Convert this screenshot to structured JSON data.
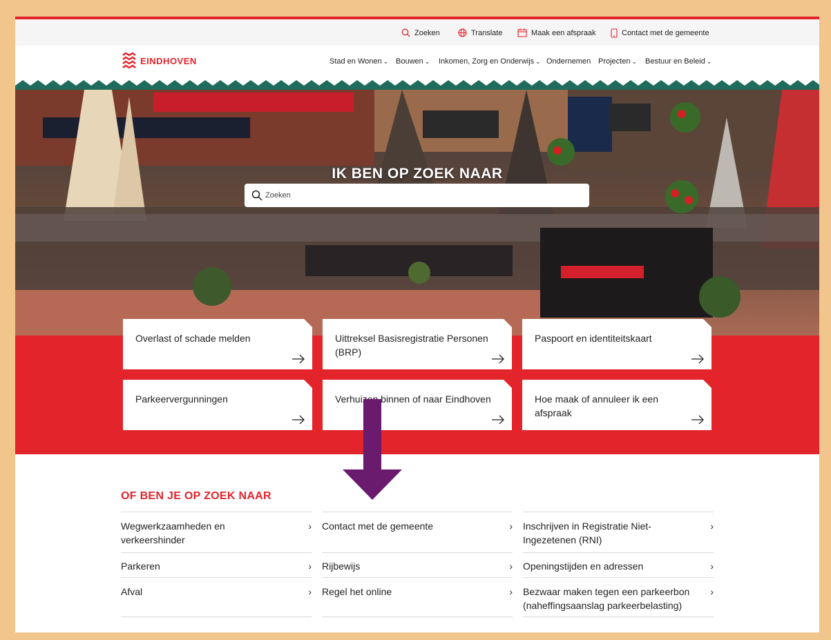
{
  "utility_bar": {
    "search": "Zoeken",
    "translate": "Translate",
    "appointment": "Maak een afspraak",
    "contact": "Contact met de gemeente"
  },
  "logo": {
    "text": "EINDHOVEN"
  },
  "nav": [
    {
      "label": "Stad en Wonen",
      "dropdown": true
    },
    {
      "label": "Bouwen",
      "dropdown": true
    },
    {
      "label": "Inkomen, Zorg en Onderwijs",
      "dropdown": true
    },
    {
      "label": "Ondernemen",
      "dropdown": false
    },
    {
      "label": "Projecten",
      "dropdown": true
    },
    {
      "label": "Bestuur en Beleid",
      "dropdown": true
    }
  ],
  "hero": {
    "title": "IK BEN OP ZOEK NAAR",
    "search_placeholder": "Zoeken"
  },
  "tiles": [
    {
      "label": "Overlast of schade melden"
    },
    {
      "label": "Uittreksel Basisregistratie Personen (BRP)"
    },
    {
      "label": "Paspoort en identiteitskaart"
    },
    {
      "label": "Parkeervergunningen"
    },
    {
      "label": "Verhuizen binnen of naar Eindhoven"
    },
    {
      "label": "Hoe maak of annuleer ik een afspraak"
    }
  ],
  "more": {
    "title": "OF BEN JE OP ZOEK NAAR",
    "links": [
      {
        "label": "Wegwerkzaamheden en verkeershinder"
      },
      {
        "label": "Contact met de gemeente"
      },
      {
        "label": "Inschrijven in Registratie Niet-Ingezetenen (RNI)"
      },
      {
        "label": "Parkeren"
      },
      {
        "label": "Rijbewijs"
      },
      {
        "label": "Openingstijden en adressen"
      },
      {
        "label": "Afval"
      },
      {
        "label": "Regel het online"
      },
      {
        "label": "Bezwaar maken tegen een parkeerbon (naheffingsaanslag parkeerbelasting)"
      }
    ]
  },
  "colors": {
    "brand_red": "#e3242b",
    "zigzag_green": "#1f6b5c",
    "annotation_arrow": "#6a1b6e",
    "outer_frame": "#f2c58c"
  }
}
